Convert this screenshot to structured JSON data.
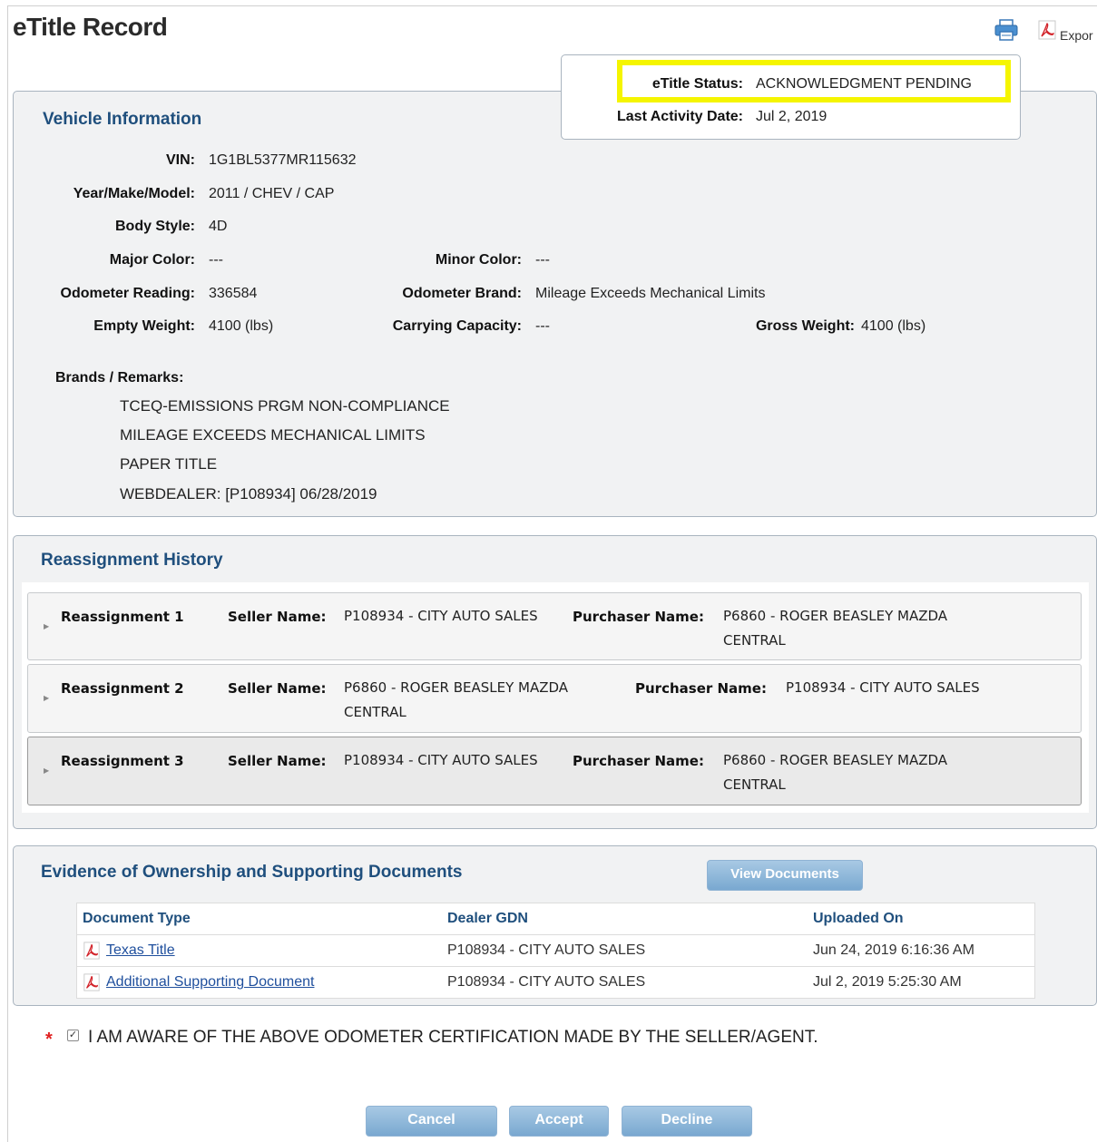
{
  "header": {
    "title": "eTitle Record",
    "export_label": "Expor"
  },
  "status": {
    "status_label": "eTitle Status:",
    "status_value": "ACKNOWLEDGMENT PENDING",
    "activity_label": "Last Activity Date:",
    "activity_value": "Jul 2, 2019"
  },
  "vehicle": {
    "title": "Vehicle Information",
    "vin_label": "VIN:",
    "vin": "1G1BL5377MR115632",
    "ymm_label": "Year/Make/Model:",
    "ymm": "2011 / CHEV / CAP",
    "body_label": "Body Style:",
    "body": "4D",
    "major_color_label": "Major Color:",
    "major_color": "---",
    "minor_color_label": "Minor Color:",
    "minor_color": "---",
    "odometer_label": "Odometer Reading:",
    "odometer": "336584",
    "odometer_brand_label": "Odometer Brand:",
    "odometer_brand": "Mileage Exceeds Mechanical Limits",
    "empty_weight_label": "Empty Weight:",
    "empty_weight": "4100 (lbs)",
    "carrying_label": "Carrying Capacity:",
    "carrying": "---",
    "gross_label": "Gross Weight:",
    "gross": "4100 (lbs)",
    "remarks_label": "Brands / Remarks:",
    "remarks": [
      "TCEQ-EMISSIONS PRGM NON-COMPLIANCE",
      "MILEAGE EXCEEDS MECHANICAL LIMITS",
      "PAPER TITLE",
      "WEBDEALER: [P108934] 06/28/2019"
    ]
  },
  "reassignment": {
    "title": "Reassignment History",
    "seller_label": "Seller Name:",
    "purchaser_label": "Purchaser Name:",
    "rows": [
      {
        "title": "Reassignment 1",
        "seller": "P108934 - CITY AUTO SALES",
        "purchaser": "P6860 - ROGER BEASLEY MAZDA CENTRAL"
      },
      {
        "title": "Reassignment 2",
        "seller": "P6860 - ROGER BEASLEY MAZDA CENTRAL",
        "purchaser": "P108934 - CITY AUTO SALES"
      },
      {
        "title": "Reassignment 3",
        "seller": "P108934 - CITY AUTO SALES",
        "purchaser": "P6860 - ROGER BEASLEY MAZDA CENTRAL"
      }
    ]
  },
  "documents": {
    "title": "Evidence of Ownership and Supporting Documents",
    "view_button": "View Documents",
    "columns": [
      "Document Type",
      "Dealer GDN",
      "Uploaded On"
    ],
    "rows": [
      {
        "type": "Texas Title",
        "gdn": "P108934 - CITY AUTO SALES",
        "uploaded": "Jun 24, 2019 6:16:36 AM"
      },
      {
        "type": "Additional Supporting Document",
        "gdn": "P108934 - CITY AUTO SALES",
        "uploaded": "Jul 2, 2019 5:25:30 AM"
      }
    ]
  },
  "certification": {
    "required_mark": "*",
    "checked": true,
    "text": "I AM AWARE OF THE ABOVE ODOMETER CERTIFICATION MADE BY THE SELLER/AGENT."
  },
  "actions": {
    "cancel": "Cancel",
    "accept": "Accept",
    "decline": "Decline"
  },
  "icons": {
    "print": "printer-icon",
    "pdf": "pdf-icon",
    "expand": "triangle-right-icon"
  },
  "colors": {
    "heading_blue": "#1f4f7d",
    "highlight_yellow": "#f5f500",
    "button_blue": "#8fb3d4",
    "required_red": "#e02020"
  }
}
